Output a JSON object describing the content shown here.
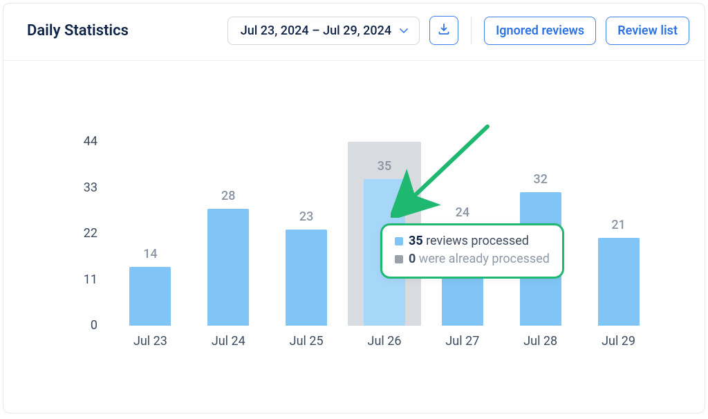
{
  "header": {
    "title": "Daily Statistics",
    "date_range": "Jul 23, 2024 – Jul 29, 2024",
    "ignored_btn": "Ignored reviews",
    "review_list_btn": "Review list"
  },
  "tooltip": {
    "processed_value": "35",
    "processed_label": " reviews processed",
    "already_value": "0",
    "already_label": " were already processed"
  },
  "chart_data": {
    "type": "bar",
    "categories": [
      "Jul 23",
      "Jul 24",
      "Jul 25",
      "Jul 26",
      "Jul 27",
      "Jul 28",
      "Jul 29"
    ],
    "values": [
      14,
      28,
      23,
      35,
      24,
      32,
      21
    ],
    "value_labels": [
      "14",
      "28",
      "23",
      "35",
      "24",
      "32",
      "21"
    ],
    "highlight_index": 3,
    "highlight_ghost_value": 44,
    "title": "Daily Statistics",
    "xlabel": "",
    "ylabel": "",
    "ylim": [
      0,
      44
    ],
    "yticks": [
      0,
      11,
      22,
      33,
      44
    ],
    "ytick_labels": [
      "0",
      "11",
      "22",
      "33",
      "44"
    ],
    "colors": {
      "bar": "#80c5f5",
      "bar_highlight": "#a6d6f8",
      "ghost": "#d8dbdf"
    }
  }
}
